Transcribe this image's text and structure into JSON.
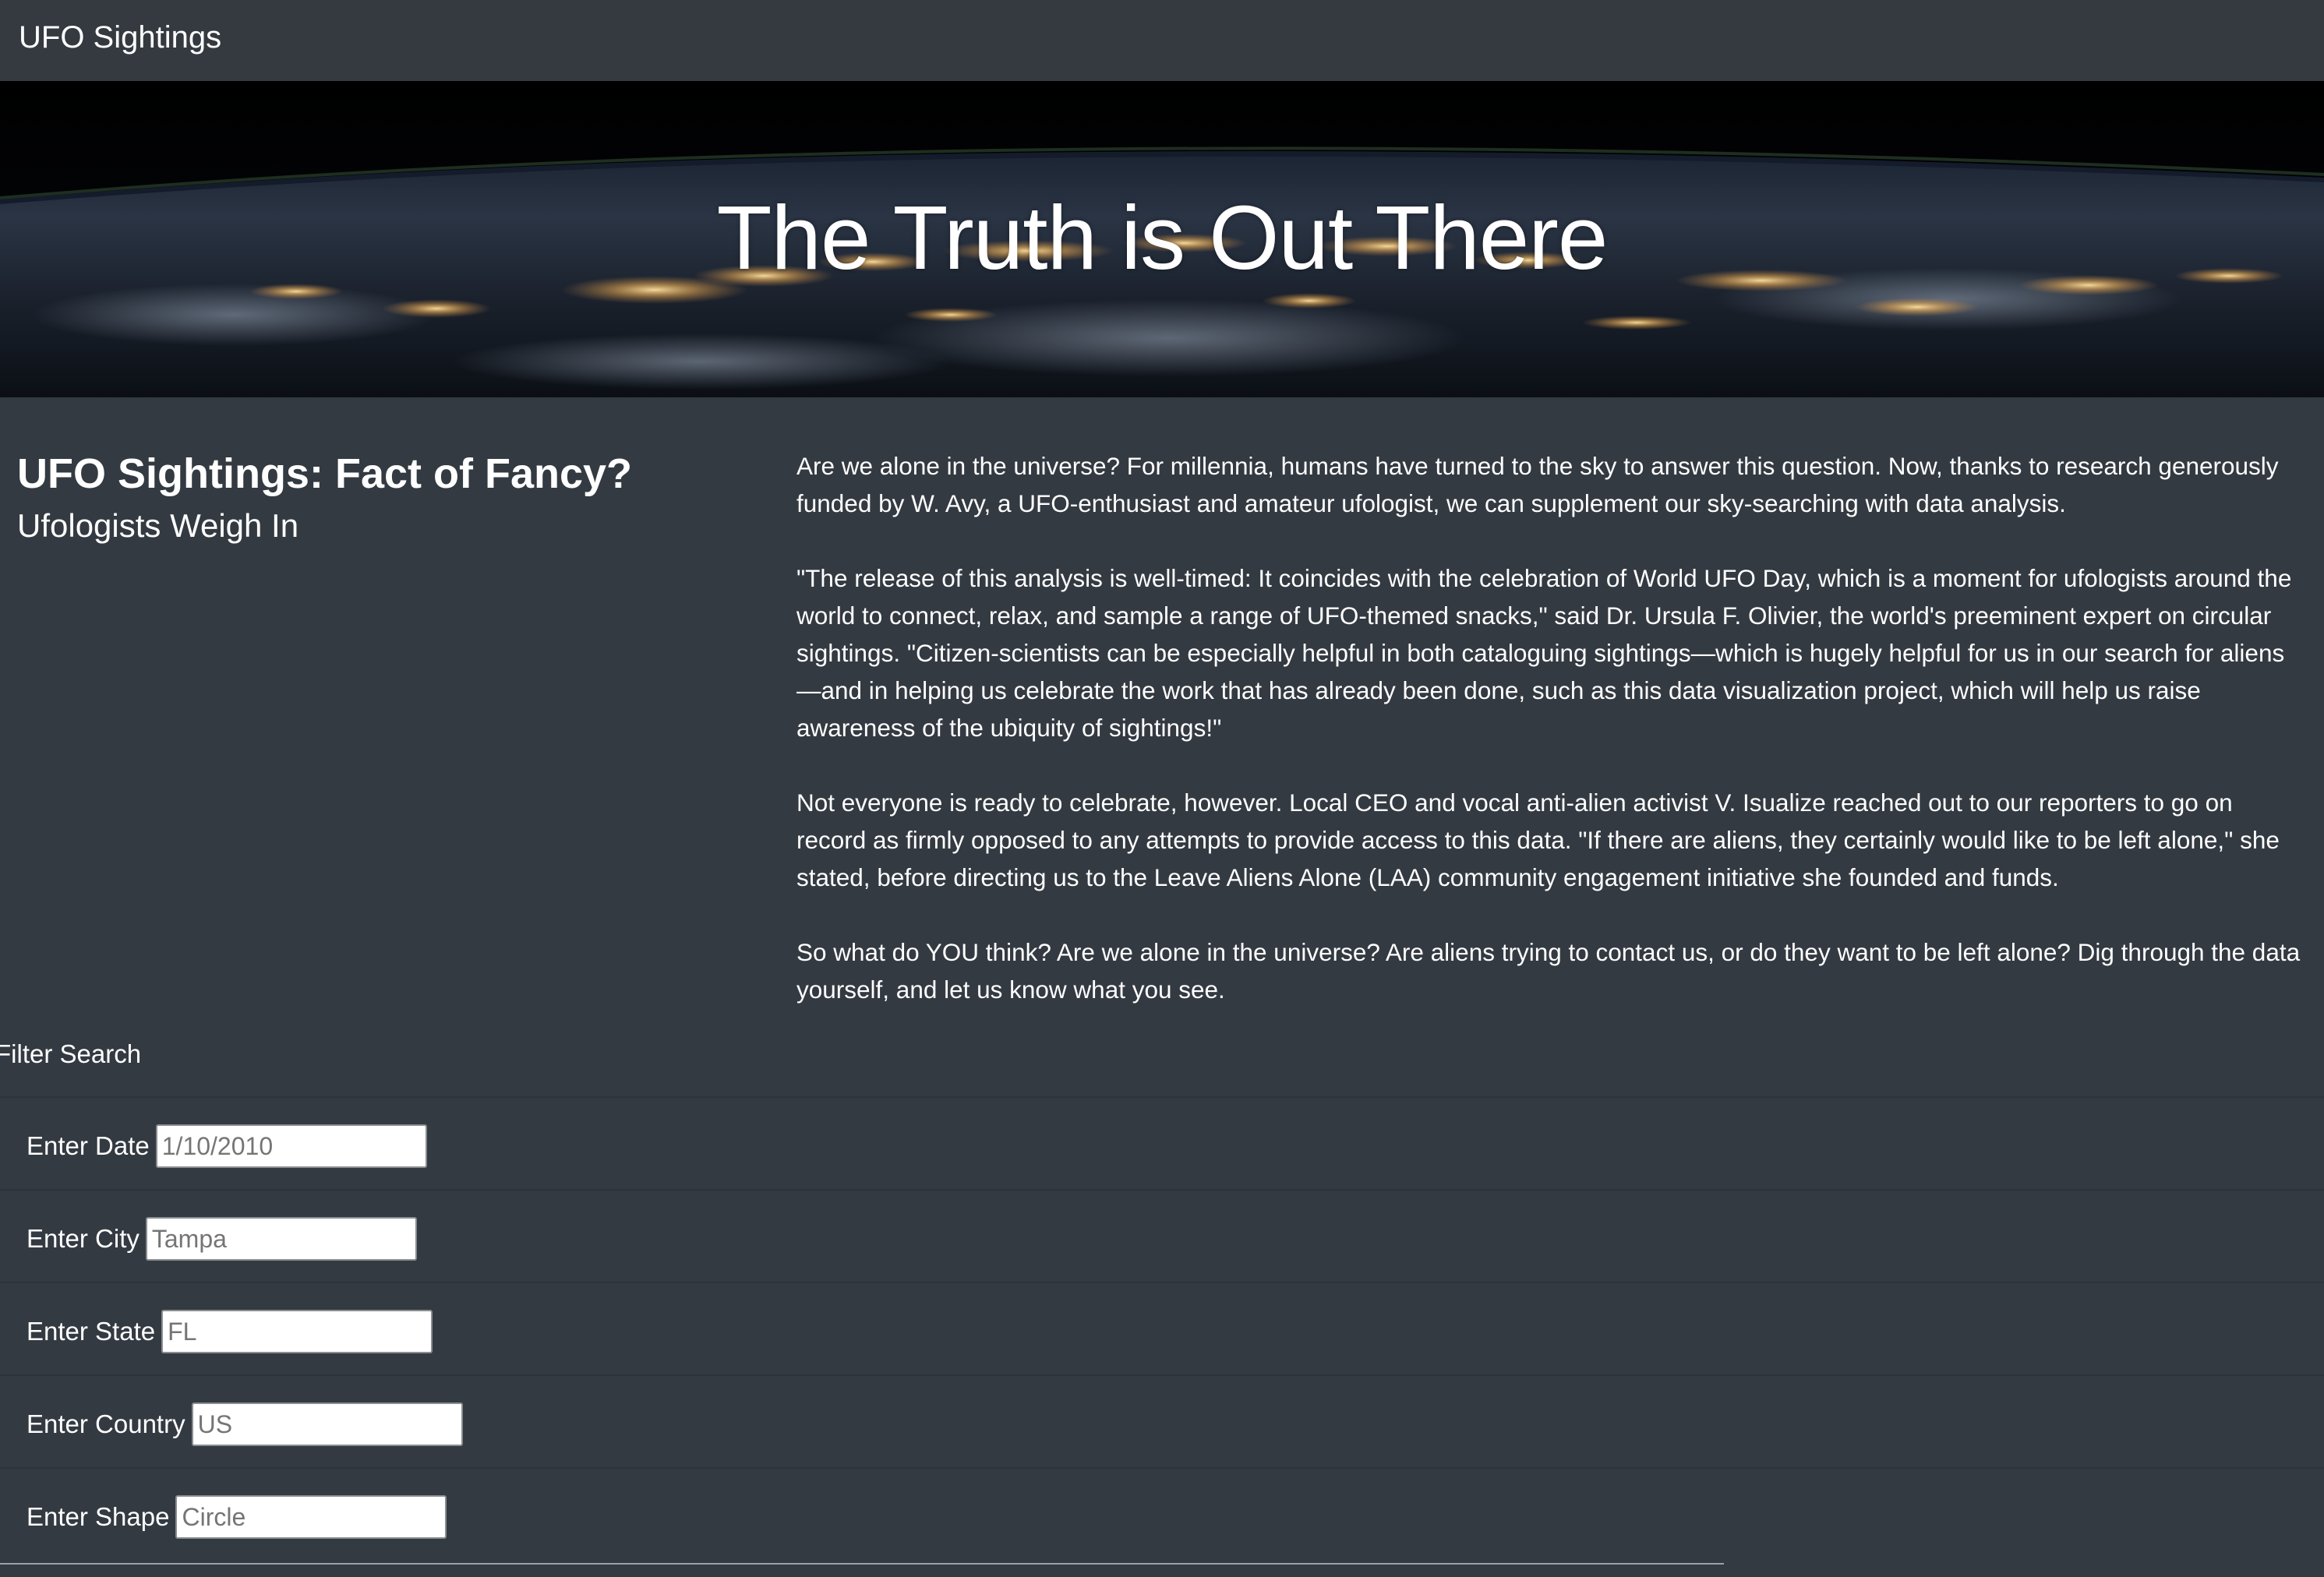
{
  "navbar": {
    "brand": "UFO Sightings"
  },
  "hero": {
    "title": "The Truth is Out There"
  },
  "article": {
    "title": "UFO Sightings: Fact of Fancy?",
    "subtitle": "Ufologists Weigh In",
    "paragraphs": [
      "Are we alone in the universe? For millennia, humans have turned to the sky to answer this question. Now, thanks to research generously funded by W. Avy, a UFO-enthusiast and amateur ufologist, we can supplement our sky-searching with data analysis.",
      "\"The release of this analysis is well-timed: It coincides with the celebration of World UFO Day, which is a moment for ufologists around the world to connect, relax, and sample a range of UFO-themed snacks,\" said Dr. Ursula F. Olivier, the world's preeminent expert on circular sightings. \"Citizen-scientists can be especially helpful in both cataloguing sightings—which is hugely helpful for us in our search for aliens—and in helping us celebrate the work that has already been done, such as this data visualization project, which will help us raise awareness of the ubiquity of sightings!\"",
      "Not everyone is ready to celebrate, however. Local CEO and vocal anti-alien activist V. Isualize reached out to our reporters to go on record as firmly opposed to any attempts to provide access to this data. \"If there are aliens, they certainly would like to be left alone,\" she stated, before directing us to the Leave Aliens Alone (LAA) community engagement initiative she founded and funds.",
      "So what do YOU think? Are we alone in the universe? Are aliens trying to contact us, or do they want to be left alone? Dig through the data yourself, and let us know what you see."
    ]
  },
  "filters": {
    "title": "Filter Search",
    "items": [
      {
        "label": "Enter Date",
        "placeholder": "1/10/2010",
        "value": ""
      },
      {
        "label": "Enter City",
        "placeholder": "Tampa",
        "value": ""
      },
      {
        "label": "Enter State",
        "placeholder": "FL",
        "value": ""
      },
      {
        "label": "Enter Country",
        "placeholder": "US",
        "value": ""
      },
      {
        "label": "Enter Shape",
        "placeholder": "Circle",
        "value": ""
      }
    ]
  }
}
